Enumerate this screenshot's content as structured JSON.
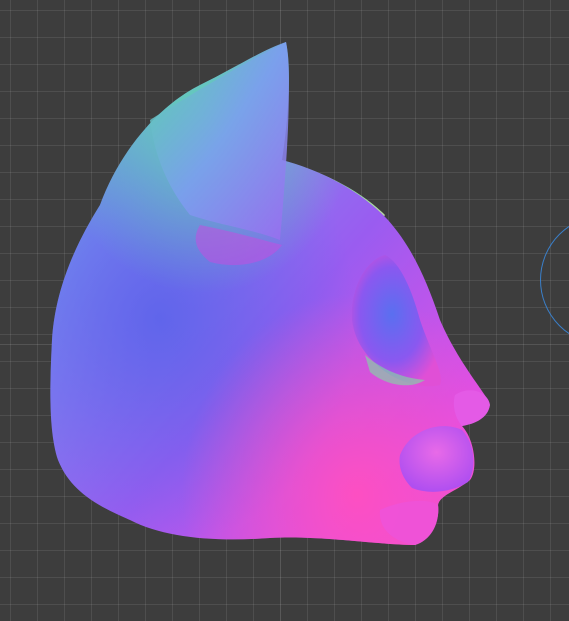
{
  "viewport": {
    "background_color": "#3d3d3d",
    "grid_visible": true,
    "grid_line_color": "#4a4a4a"
  },
  "model": {
    "shading": "normal-map",
    "object": "cat-head-mesh",
    "view": "side-profile"
  },
  "gizmo": {
    "type": "rotation-ring",
    "color": "#3a7fc9"
  }
}
